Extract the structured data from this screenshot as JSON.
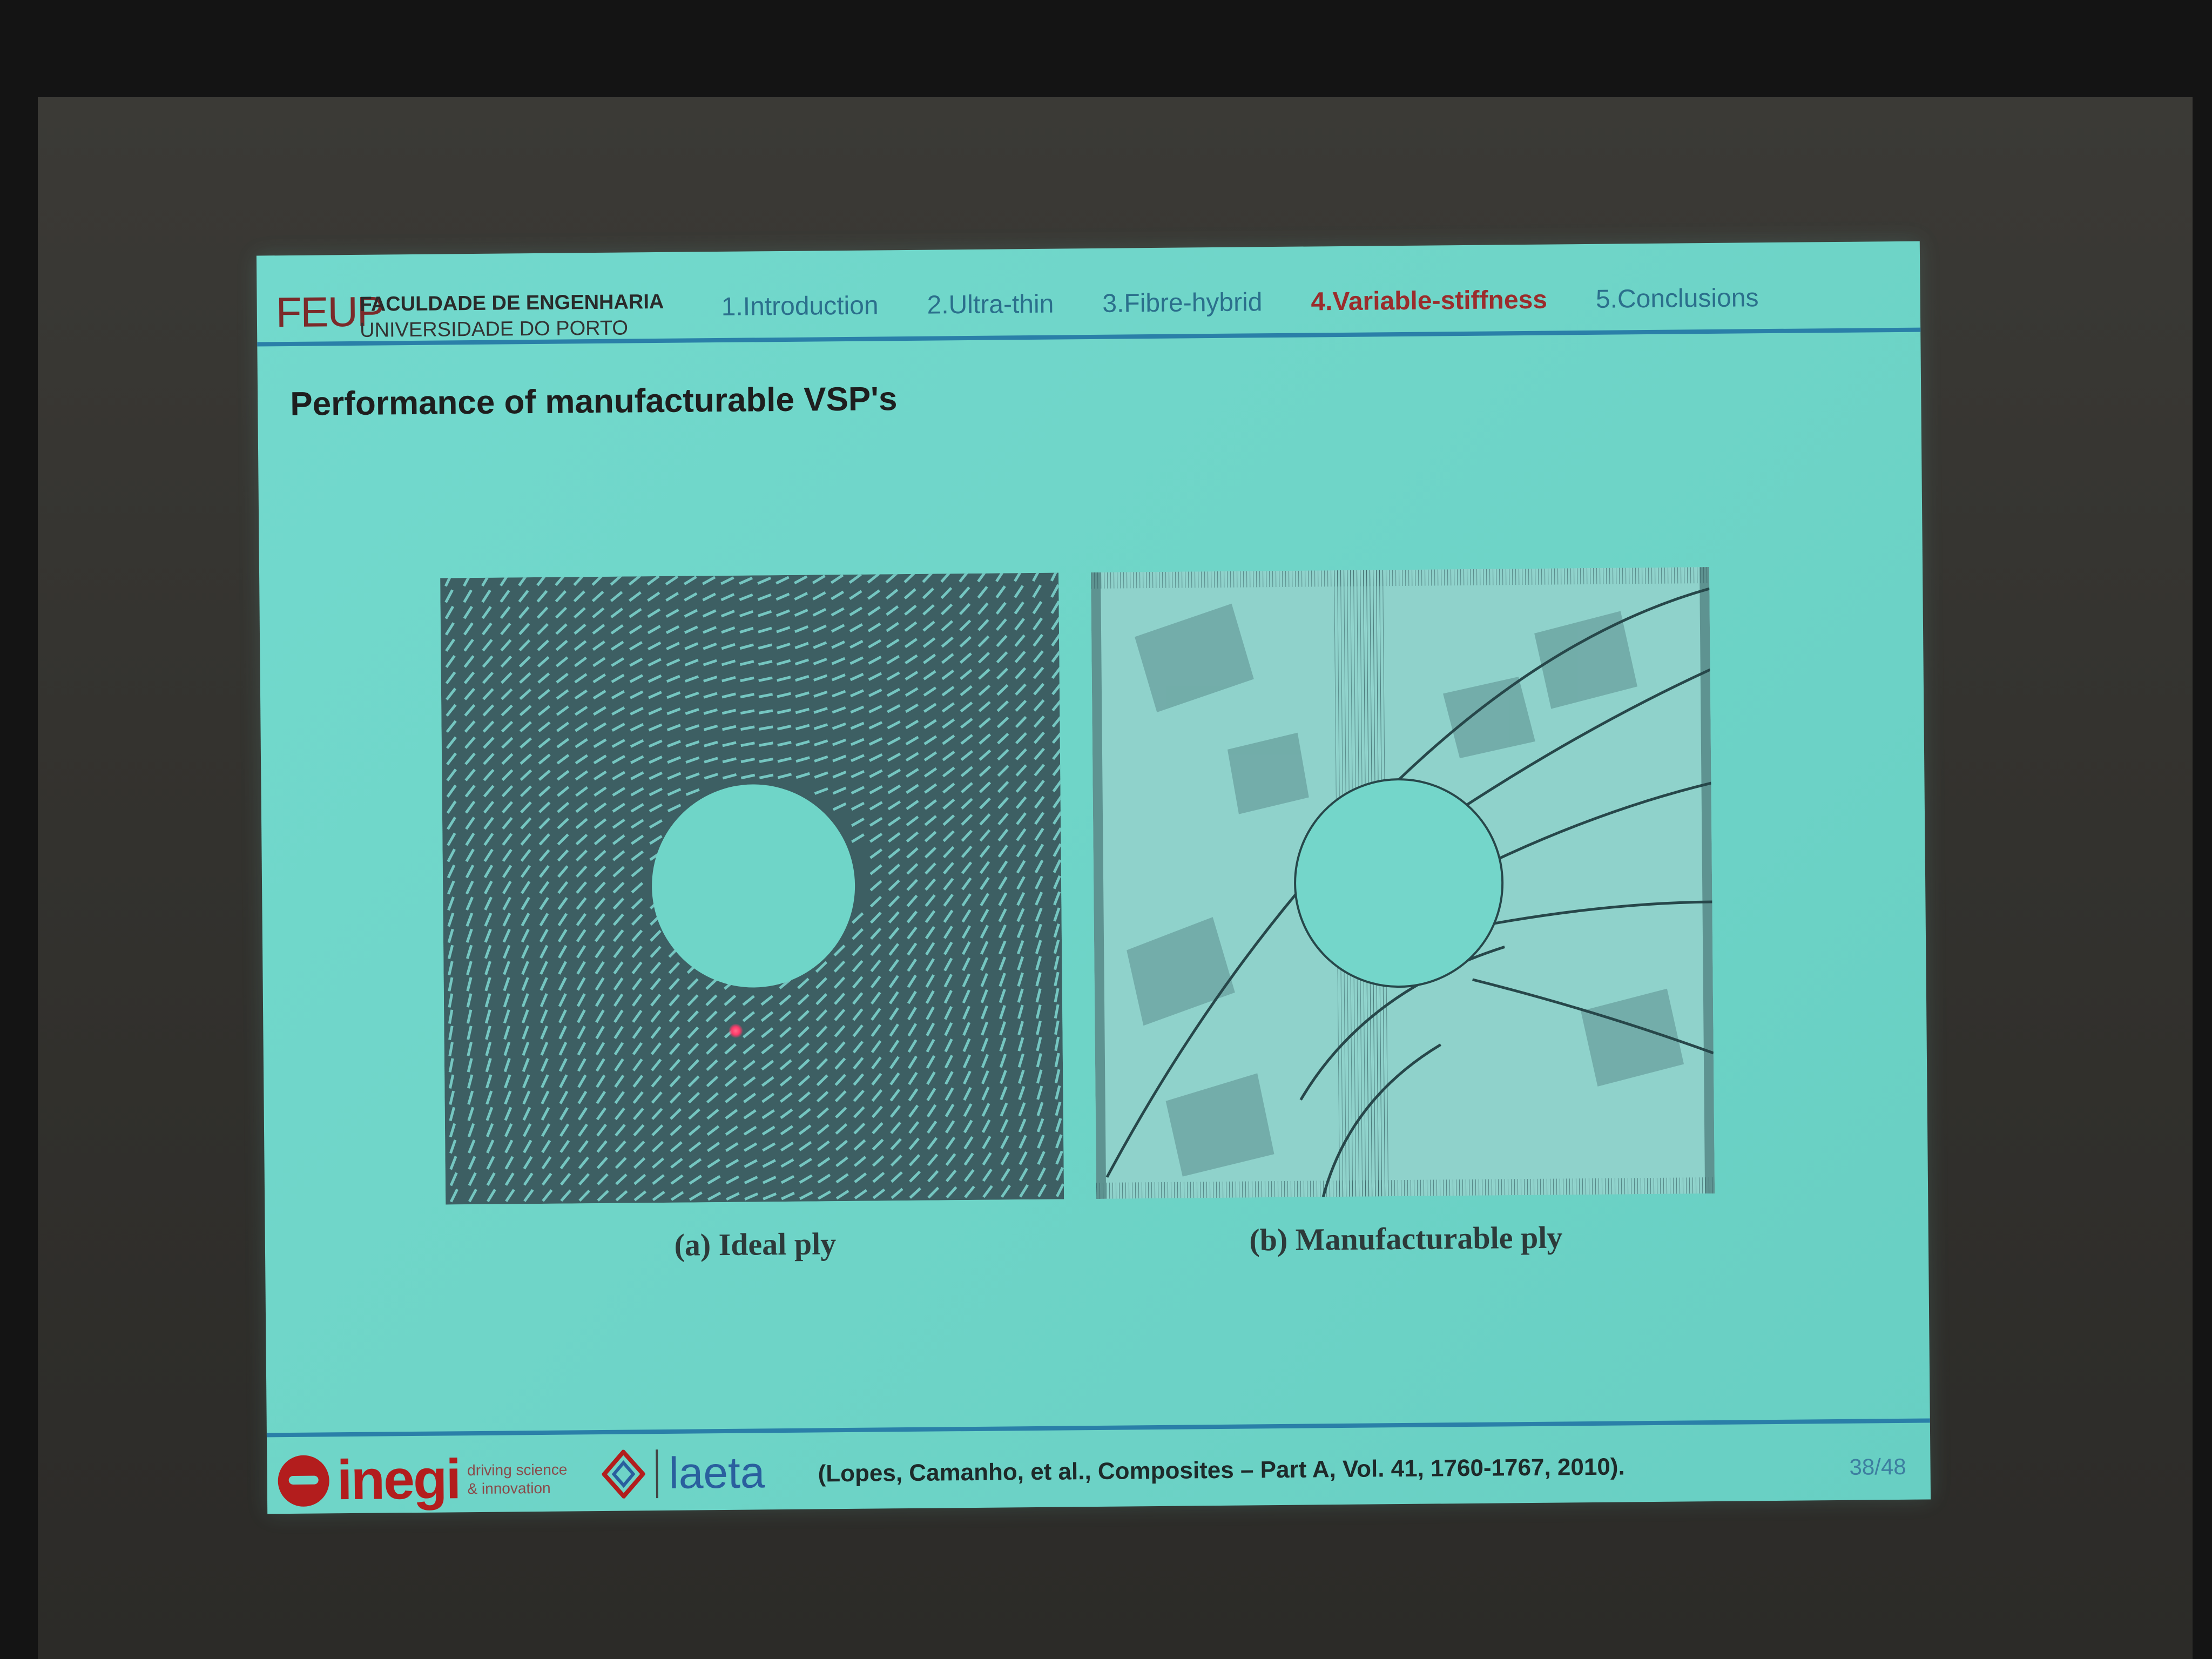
{
  "header": {
    "logo": "FEUP",
    "institution_line1": "FACULDADE DE ENGENHARIA",
    "institution_line2": "UNIVERSIDADE DO PORTO",
    "nav": [
      {
        "label": "1.Introduction"
      },
      {
        "label": "2.Ultra-thin"
      },
      {
        "label": "3.Fibre-hybrid"
      },
      {
        "label": "4.Variable-stiffness"
      },
      {
        "label": "5.Conclusions"
      }
    ],
    "active_index": 3
  },
  "title": "Performance of manufacturable VSP's",
  "figures": [
    {
      "caption": "(a) Ideal ply"
    },
    {
      "caption": "(b) Manufacturable ply"
    }
  ],
  "footer": {
    "inegi_word": "inegi",
    "inegi_tag_line1": "driving science",
    "inegi_tag_line2": "& innovation",
    "laeta_word": "laeta",
    "reference": "(Lopes, Camanho, et al., Composites – Part A, Vol. 41, 1760-1767, 2010).",
    "page_number": "38/48"
  },
  "colors": {
    "slide_bg": "#6fd5c8",
    "rule": "#2a7fa8",
    "active_nav": "#9b2c2c",
    "nav": "#2b6f8c",
    "inegi_red": "#b31d1d",
    "laeta_blue": "#2a5f9e",
    "ideal_ply_bg": "#3d5f63",
    "fiber_line": "#7fd9d2"
  }
}
